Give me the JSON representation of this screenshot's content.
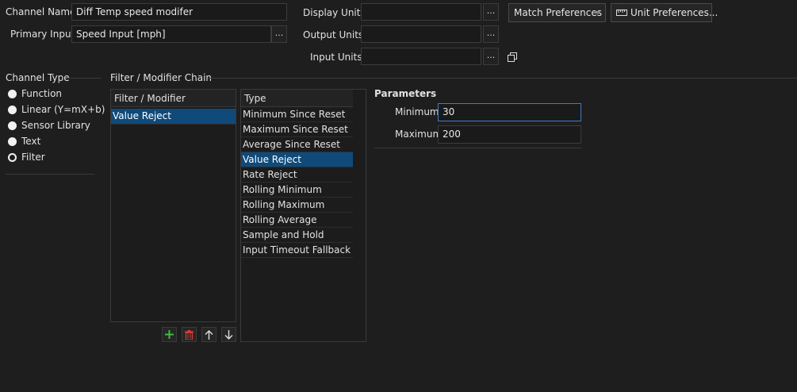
{
  "header": {
    "channel_name_label": "Channel Name",
    "channel_name_value": "Diff Temp speed modifer",
    "primary_input_label": "Primary Input",
    "primary_input_value": "Speed Input [mph]",
    "ellipsis": "...",
    "display_units_label": "Display Units",
    "output_units_label": "Output Units",
    "input_units_label": "Input Units",
    "match_preferences": "Match Preferences",
    "unit_preferences": "Unit Preferences..."
  },
  "channel_type": {
    "title": "Channel Type",
    "options": [
      "Function",
      "Linear (Y=mX+b)",
      "Sensor Library",
      "Text",
      "Filter"
    ],
    "selected": "Filter"
  },
  "chain": {
    "title": "Filter / Modifier Chain",
    "list_header": "Filter / Modifier",
    "items": [
      "Value Reject"
    ]
  },
  "type_list": {
    "header": "Type",
    "items": [
      "Minimum Since Reset",
      "Maximum Since Reset",
      "Average Since Reset",
      "Value Reject",
      "Rate Reject",
      "Rolling Minimum",
      "Rolling Maximum",
      "Rolling Average",
      "Sample and Hold",
      "Input Timeout Fallback"
    ],
    "selected": "Value Reject"
  },
  "parameters": {
    "title": "Parameters",
    "minimum_label": "Minimum",
    "minimum_value": "30",
    "maximum_label": "Maximum",
    "maximum_value": "200"
  },
  "colors": {
    "background": "#1e1e1e",
    "selection": "#0f4a7a",
    "focus_border": "#3d7fc4",
    "add_green": "#3cbf3c",
    "delete_red": "#d83a3a"
  }
}
